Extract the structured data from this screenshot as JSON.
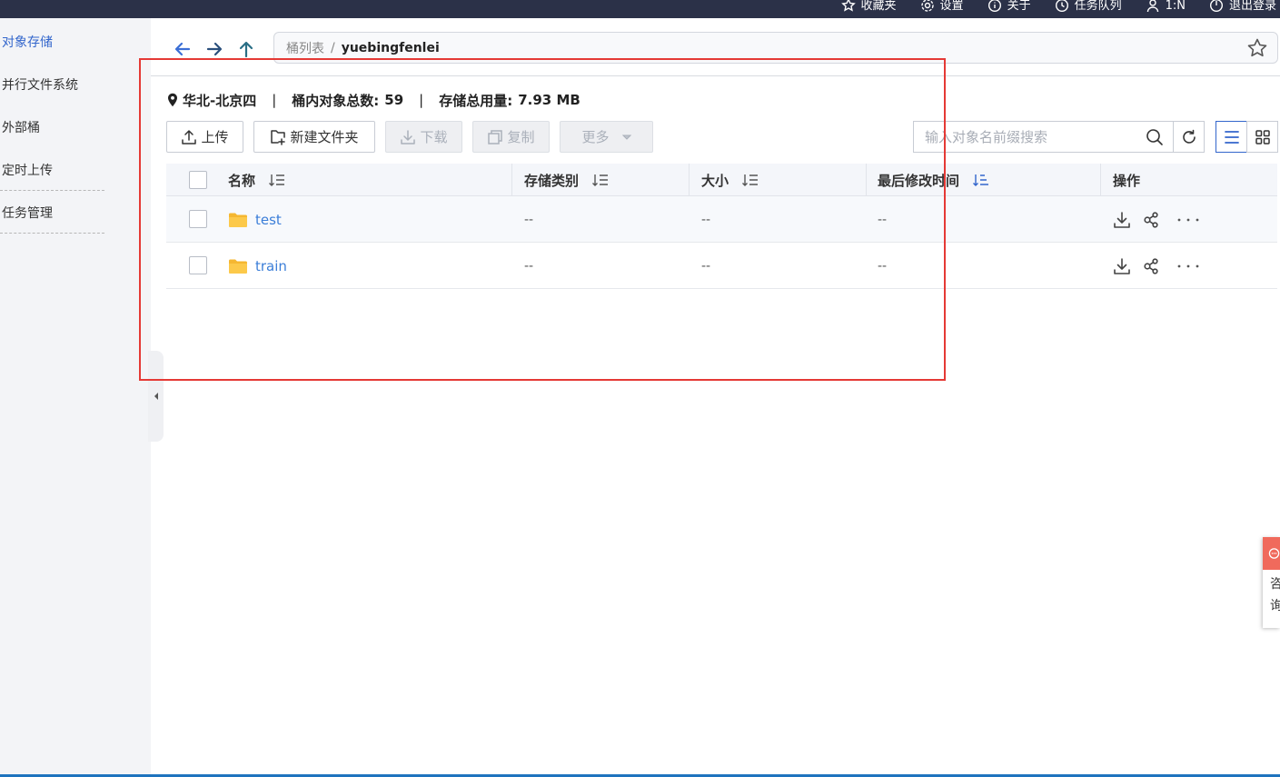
{
  "topbar": {
    "items": [
      {
        "label": "收藏夹",
        "icon": "star-icon"
      },
      {
        "label": "设置",
        "icon": "gear-icon"
      },
      {
        "label": "关于",
        "icon": "info-icon"
      },
      {
        "label": "任务队列",
        "icon": "clock-icon"
      },
      {
        "label": "1:N",
        "icon": "user-icon"
      },
      {
        "label": "退出登录",
        "icon": "power-icon"
      }
    ]
  },
  "sidebar": {
    "items": [
      {
        "label": "对象存储",
        "active": true
      },
      {
        "label": "并行文件系统",
        "active": false
      },
      {
        "label": "外部桶",
        "active": false
      },
      {
        "label": "定时上传",
        "active": false
      },
      {
        "label": "任务管理",
        "active": false
      }
    ]
  },
  "breadcrumb": {
    "root": "桶列表",
    "separator": "/",
    "current": "yuebingfenlei"
  },
  "info": {
    "region": "华北-北京四",
    "object_count_label": "桶内对象总数:",
    "object_count": "59",
    "storage_label": "存储总用量:",
    "storage_used": "7.93 MB",
    "separator": "|"
  },
  "toolbar": {
    "upload_label": "上传",
    "new_folder_label": "新建文件夹",
    "download_label": "下载",
    "copy_label": "复制",
    "more_label": "更多"
  },
  "search": {
    "placeholder": "输入对象名前缀搜索",
    "value": ""
  },
  "table": {
    "columns": {
      "name": "名称",
      "storage_class": "存储类别",
      "size": "大小",
      "modified": "最后修改时间",
      "actions": "操作"
    },
    "rows": [
      {
        "name": "test",
        "storage_class": "--",
        "size": "--",
        "modified": "--"
      },
      {
        "name": "train",
        "storage_class": "--",
        "size": "--",
        "modified": "--"
      }
    ]
  },
  "float_tab": {
    "label": "咨询"
  },
  "colors": {
    "topbar": "#2b3148",
    "accent": "#3366cc",
    "link": "#3b7ed8",
    "folder": "#f5b731",
    "highlight": "#e53935"
  }
}
